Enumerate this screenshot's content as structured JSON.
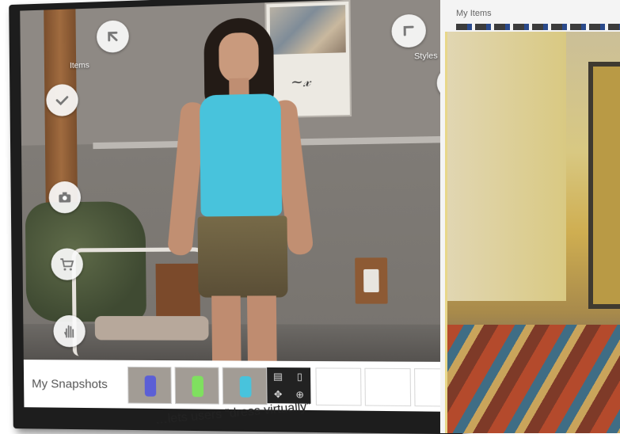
{
  "kiosk": {
    "items_label": "Items",
    "styles_label": "Styles",
    "buttons": {
      "items_arrow": "arrow-up-left-icon",
      "styles_arrow": "arrow-up-left-icon",
      "back_check": "check-icon",
      "styles_check": "check-icon",
      "camera": "camera-icon",
      "cart": "shopping-cart-icon",
      "hand": "hand-icon"
    }
  },
  "snapshots": {
    "label": "My Snapshots",
    "thumbnails": [
      {
        "shirt_color": "#5b5fd6"
      },
      {
        "shirt_color": "#7fe05f"
      },
      {
        "shirt_color": "#48c3dc"
      }
    ],
    "tools": [
      "save-icon",
      "delete-icon",
      "move-icon",
      "zoom-icon"
    ]
  },
  "caption": "…lets users “dress virtually”",
  "right_panel": {
    "title": "My Items"
  }
}
